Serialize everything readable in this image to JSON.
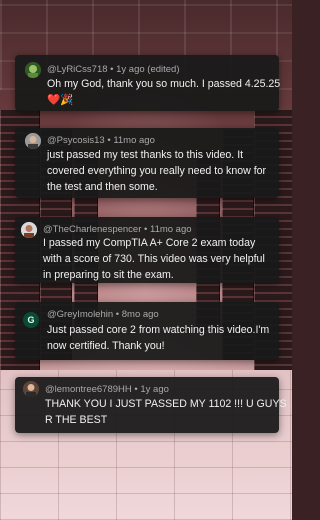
{
  "comments": [
    {
      "author": "@LyRiCss718",
      "age": "1y ago (edited)",
      "lines": [
        "Oh my God, thank you so much. I passed 4.25.25",
        "❤️🎉"
      ]
    },
    {
      "author": "@Psycosis13",
      "age": "11mo ago",
      "lines": [
        "just passed my test thanks to this video. It",
        "covered everything you really need to know for",
        "the test and then some."
      ]
    },
    {
      "author": "@TheCharlenespencer",
      "age": "11mo ago",
      "lines": [
        "I passed my CompTIA A+ Core 2 exam today",
        "with a score of 730. This video was very helpful",
        "in preparing to sit the exam."
      ]
    },
    {
      "author": "@GreyImolehin",
      "age": "8mo ago",
      "avatar_letter": "G",
      "lines": [
        "Just passed core 2 from watching this video.I'm",
        "now certified.  Thank you!"
      ]
    },
    {
      "author": "@lemontree6789HH",
      "age": "1y ago",
      "lines": [
        "THANK YOU I JUST PASSED MY 1102 !!! U GUYS",
        "R THE BEST"
      ]
    }
  ],
  "separator": " • ",
  "colors": {
    "card_bg": "#1a1a1a",
    "meta": "#aaaaaa",
    "text": "#f1f1f1",
    "avatar_g": "#0b4a35"
  }
}
